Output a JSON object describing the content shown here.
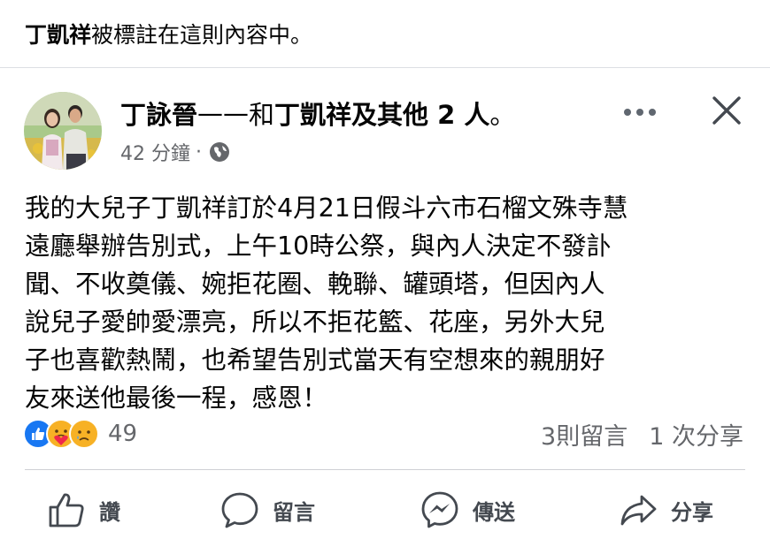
{
  "banner": {
    "tagged_name": "丁凱祥",
    "text": "被標註在這則內容中。"
  },
  "post": {
    "author": "丁詠晉",
    "dash": "——",
    "with_text": "和",
    "tagged": "丁凱祥",
    "others_text": "及其他 2 人",
    "period": "。",
    "time": "42 分鐘",
    "dot": "·",
    "privacy_icon": "globe-icon",
    "body_lines": [
      "我的大兒子丁凱祥訂於4月21日假斗六市石榴文殊寺慧",
      "遠廳舉辦告別式，上午10時公祭，與內人決定不發訃",
      "聞、不收奠儀、婉拒花圈、輓聯、罐頭塔，但因內人",
      "說兒子愛帥愛漂亮，所以不拒花籃、花座，另外大兒",
      "子也喜歡熱鬧，也希望告別式當天有空想來的親朋好",
      "友來送他最後一程，感恩！"
    ]
  },
  "reactions": {
    "icons": [
      "like-reaction-icon",
      "care-reaction-icon",
      "sad-reaction-icon"
    ],
    "count": "49"
  },
  "stats": {
    "comments": "3則留言",
    "shares": "1 次分享"
  },
  "actions": {
    "like": "讚",
    "comment": "留言",
    "send": "傳送",
    "share": "分享"
  },
  "colors": {
    "like_blue": "#1877f2",
    "reaction_yellow": "#f7b125",
    "secondary_text": "#65676b"
  }
}
